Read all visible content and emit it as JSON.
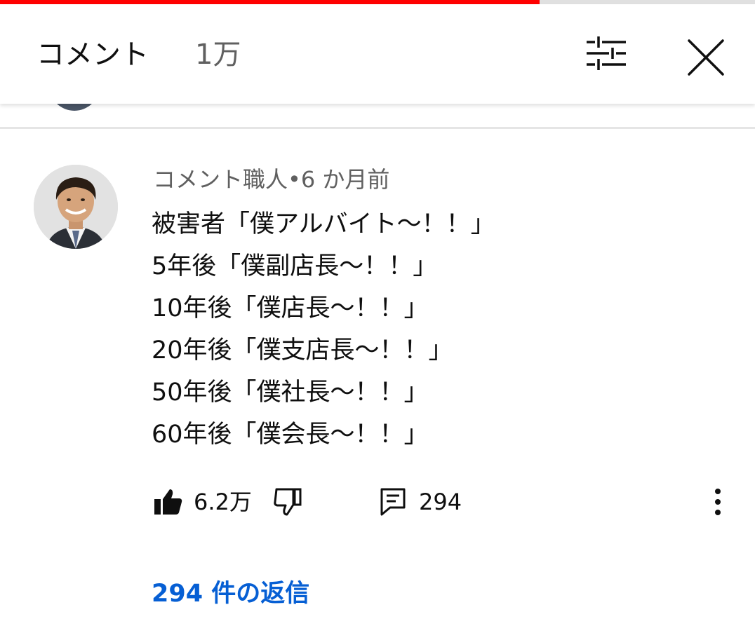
{
  "video_progress": 0.715,
  "header": {
    "title": "コメント",
    "count": "1万",
    "filter_icon": "sort-filter-icon",
    "close_icon": "close-icon"
  },
  "comment": {
    "author": "コメント職人",
    "separator": "•",
    "time": "6 か月前",
    "lines": [
      "被害者「僕アルバイト～！！」",
      "5年後「僕副店長～！！」",
      "10年後「僕店長～！！」",
      "20年後「僕支店長～！！」",
      "50年後「僕社長～！！」",
      "60年後「僕会長～！！」"
    ],
    "like_count": "6.2万",
    "reply_count": "294",
    "replies_link": "294 件の返信"
  },
  "colors": {
    "progress": "#ff0000",
    "link": "#065fd4",
    "secondary_text": "#606060"
  }
}
